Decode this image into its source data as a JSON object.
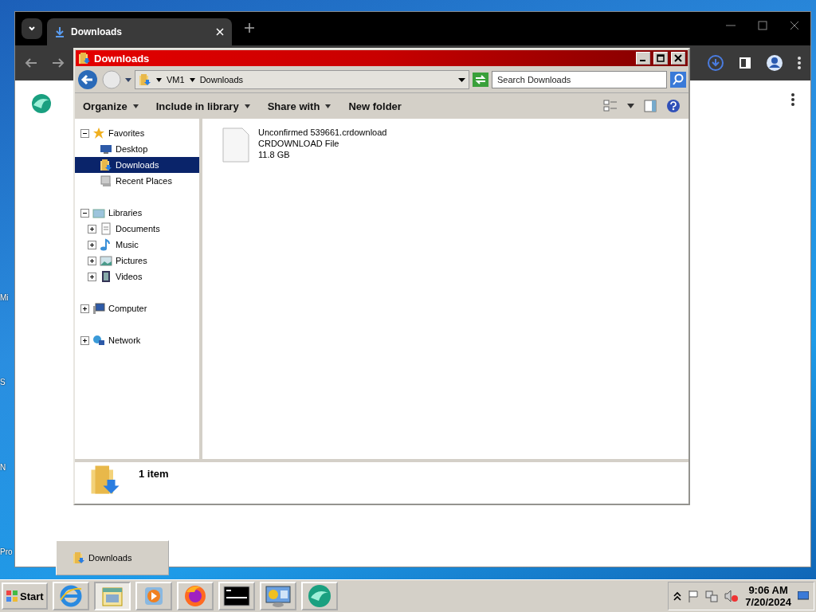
{
  "desktop": {
    "icon_labels": [
      "Mi",
      "S",
      "N",
      "Pro"
    ]
  },
  "browser": {
    "tab": {
      "title": "Downloads",
      "selected": true
    }
  },
  "explorer": {
    "title": "Downloads",
    "breadcrumb": [
      "VM1",
      "Downloads"
    ],
    "search": {
      "placeholder": "Search Downloads"
    },
    "commands": [
      {
        "label": "Organize",
        "has_menu": true
      },
      {
        "label": "Include in library",
        "has_menu": true
      },
      {
        "label": "Share with",
        "has_menu": true
      },
      {
        "label": "New folder",
        "has_menu": false
      }
    ],
    "tree": [
      {
        "label": "Favorites",
        "kind": "favorites",
        "expanded": true,
        "selected": false,
        "children": [
          {
            "label": "Desktop",
            "kind": "desktop",
            "selected": false
          },
          {
            "label": "Downloads",
            "kind": "downloads",
            "selected": true
          },
          {
            "label": "Recent Places",
            "kind": "recent",
            "selected": false
          }
        ]
      },
      {
        "label": "Libraries",
        "kind": "libraries",
        "expanded": true,
        "selected": false,
        "children": [
          {
            "label": "Documents",
            "kind": "documents",
            "expanded": false,
            "selected": false
          },
          {
            "label": "Music",
            "kind": "music",
            "expanded": false,
            "selected": false
          },
          {
            "label": "Pictures",
            "kind": "pictures",
            "expanded": false,
            "selected": false
          },
          {
            "label": "Videos",
            "kind": "videos",
            "expanded": false,
            "selected": false
          }
        ]
      },
      {
        "label": "Computer",
        "kind": "computer",
        "expanded": false,
        "selected": false
      },
      {
        "label": "Network",
        "kind": "network",
        "expanded": false,
        "selected": false
      }
    ],
    "files": [
      {
        "name": "Unconfirmed 539661.crdownload",
        "type": "CRDOWNLOAD File",
        "size": "11.8 GB"
      }
    ],
    "status": "1 item"
  },
  "taskbar": {
    "start": "Start",
    "thumbnail": "Downloads",
    "apps": [
      {
        "kind": "browser",
        "selected": false
      },
      {
        "kind": "explorer",
        "selected": true
      },
      {
        "kind": "media",
        "selected": false
      },
      {
        "kind": "firefox",
        "selected": false
      },
      {
        "kind": "terminal",
        "selected": false
      },
      {
        "kind": "control",
        "selected": false
      },
      {
        "kind": "sphere",
        "selected": false
      }
    ],
    "clock": {
      "time": "9:06 AM",
      "date": "7/20/2024"
    }
  }
}
